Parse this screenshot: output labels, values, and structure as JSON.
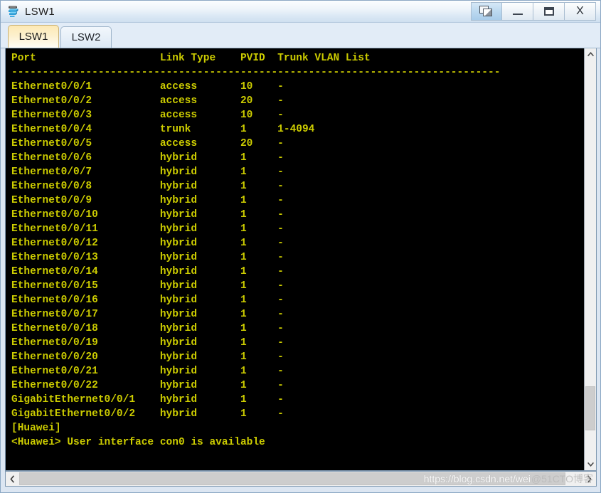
{
  "window": {
    "title": "LSW1",
    "icon": "switch-device-icon",
    "controls": [
      {
        "name": "restore-button",
        "glyph": "restore",
        "active": true
      },
      {
        "name": "minimize-button",
        "glyph": "minimize",
        "active": false
      },
      {
        "name": "maximize-button",
        "glyph": "maximize",
        "active": false
      },
      {
        "name": "close-button",
        "glyph": "X",
        "active": false
      }
    ],
    "close_label": "X"
  },
  "tabs": [
    {
      "label": "LSW1",
      "active": true
    },
    {
      "label": "LSW2",
      "active": false
    }
  ],
  "console": {
    "foreground_color": "#cccc00",
    "background_color": "#000000",
    "lines": [
      "Port                    Link Type    PVID  Trunk VLAN List",
      "-------------------------------------------------------------------------------",
      "Ethernet0/0/1           access       10    -",
      "Ethernet0/0/2           access       20    -",
      "Ethernet0/0/3           access       10    -",
      "Ethernet0/0/4           trunk        1     1-4094",
      "Ethernet0/0/5           access       20    -",
      "Ethernet0/0/6           hybrid       1     -",
      "Ethernet0/0/7           hybrid       1     -",
      "Ethernet0/0/8           hybrid       1     -",
      "Ethernet0/0/9           hybrid       1     -",
      "Ethernet0/0/10          hybrid       1     -",
      "Ethernet0/0/11          hybrid       1     -",
      "Ethernet0/0/12          hybrid       1     -",
      "Ethernet0/0/13          hybrid       1     -",
      "Ethernet0/0/14          hybrid       1     -",
      "Ethernet0/0/15          hybrid       1     -",
      "Ethernet0/0/16          hybrid       1     -",
      "Ethernet0/0/17          hybrid       1     -",
      "Ethernet0/0/18          hybrid       1     -",
      "Ethernet0/0/19          hybrid       1     -",
      "Ethernet0/0/20          hybrid       1     -",
      "Ethernet0/0/21          hybrid       1     -",
      "Ethernet0/0/22          hybrid       1     -",
      "GigabitEthernet0/0/1    hybrid       1     -",
      "GigabitEthernet0/0/2    hybrid       1     -",
      "[Huawei]",
      "<Huawei> User interface con0 is available"
    ],
    "table": {
      "columns": [
        "Port",
        "Link Type",
        "PVID",
        "Trunk VLAN List"
      ],
      "rows": [
        [
          "Ethernet0/0/1",
          "access",
          "10",
          "-"
        ],
        [
          "Ethernet0/0/2",
          "access",
          "20",
          "-"
        ],
        [
          "Ethernet0/0/3",
          "access",
          "10",
          "-"
        ],
        [
          "Ethernet0/0/4",
          "trunk",
          "1",
          "1-4094"
        ],
        [
          "Ethernet0/0/5",
          "access",
          "20",
          "-"
        ],
        [
          "Ethernet0/0/6",
          "hybrid",
          "1",
          "-"
        ],
        [
          "Ethernet0/0/7",
          "hybrid",
          "1",
          "-"
        ],
        [
          "Ethernet0/0/8",
          "hybrid",
          "1",
          "-"
        ],
        [
          "Ethernet0/0/9",
          "hybrid",
          "1",
          "-"
        ],
        [
          "Ethernet0/0/10",
          "hybrid",
          "1",
          "-"
        ],
        [
          "Ethernet0/0/11",
          "hybrid",
          "1",
          "-"
        ],
        [
          "Ethernet0/0/12",
          "hybrid",
          "1",
          "-"
        ],
        [
          "Ethernet0/0/13",
          "hybrid",
          "1",
          "-"
        ],
        [
          "Ethernet0/0/14",
          "hybrid",
          "1",
          "-"
        ],
        [
          "Ethernet0/0/15",
          "hybrid",
          "1",
          "-"
        ],
        [
          "Ethernet0/0/16",
          "hybrid",
          "1",
          "-"
        ],
        [
          "Ethernet0/0/17",
          "hybrid",
          "1",
          "-"
        ],
        [
          "Ethernet0/0/18",
          "hybrid",
          "1",
          "-"
        ],
        [
          "Ethernet0/0/19",
          "hybrid",
          "1",
          "-"
        ],
        [
          "Ethernet0/0/20",
          "hybrid",
          "1",
          "-"
        ],
        [
          "Ethernet0/0/21",
          "hybrid",
          "1",
          "-"
        ],
        [
          "Ethernet0/0/22",
          "hybrid",
          "1",
          "-"
        ],
        [
          "GigabitEthernet0/0/1",
          "hybrid",
          "1",
          "-"
        ],
        [
          "GigabitEthernet0/0/2",
          "hybrid",
          "1",
          "-"
        ]
      ],
      "prompt_config": "[Huawei]",
      "prompt_user": "<Huawei> User interface con0 is available"
    }
  },
  "scrollbars": {
    "vertical": {
      "up_arrow": "⌃",
      "down_arrow": "⌄",
      "thumb_top_pct": 82,
      "thumb_height_pct": 11
    },
    "horizontal": {
      "left_arrow": "‹",
      "right_arrow": "›",
      "thumb_width_pct": 97
    }
  },
  "watermark": {
    "url": "https://blog.csdn.net/wei",
    "tag": "@51CTO博客"
  }
}
